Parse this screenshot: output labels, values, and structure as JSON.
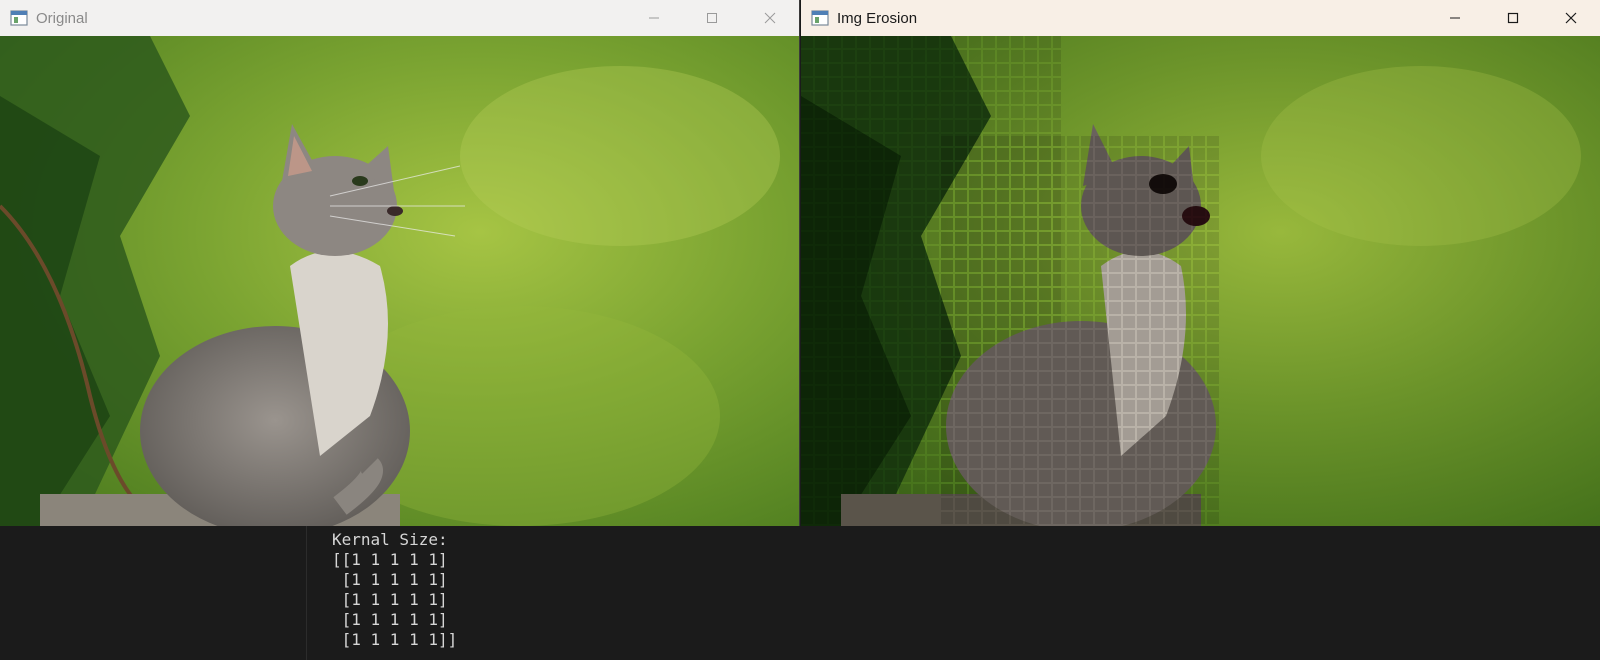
{
  "windows": {
    "original": {
      "title": "Original",
      "icon": "app-window-icon",
      "controls": [
        "minimize-icon",
        "maximize-icon",
        "close-icon"
      ]
    },
    "erosion": {
      "title": "Img Erosion",
      "icon": "app-window-icon",
      "controls": [
        "minimize-icon",
        "maximize-icon",
        "close-icon"
      ]
    }
  },
  "console": {
    "lines": [
      "Kernal Size:",
      "[[1 1 1 1 1]",
      " [1 1 1 1 1]",
      " [1 1 1 1 1]",
      " [1 1 1 1 1]",
      " [1 1 1 1 1]]"
    ]
  },
  "colors": {
    "console_bg": "#1b1b1b",
    "console_text": "#d6d6d6",
    "background_green": "#6f9a2a",
    "kitten_gray": "#8a8580"
  }
}
